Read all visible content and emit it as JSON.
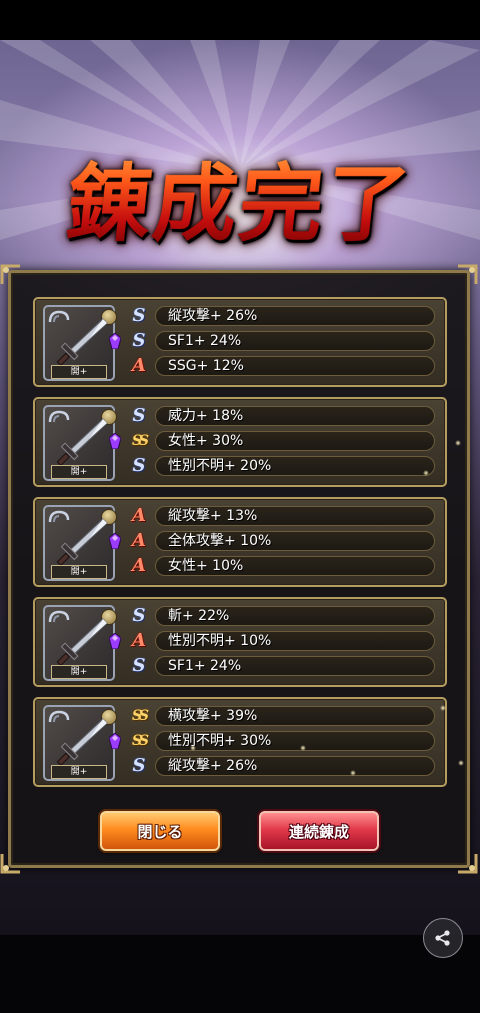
{
  "title": "錬成完了",
  "cards": [
    {
      "tag": "開+",
      "rows": [
        {
          "rank": "S",
          "text": "縦攻撃+ 26%"
        },
        {
          "rank": "S",
          "text": "SF1+ 24%"
        },
        {
          "rank": "A",
          "text": "SSG+ 12%"
        }
      ]
    },
    {
      "tag": "開+",
      "rows": [
        {
          "rank": "S",
          "text": "威力+ 18%"
        },
        {
          "rank": "SS",
          "text": "女性+ 30%"
        },
        {
          "rank": "S",
          "text": "性別不明+ 20%"
        }
      ]
    },
    {
      "tag": "開+",
      "rows": [
        {
          "rank": "A",
          "text": "縦攻撃+ 13%"
        },
        {
          "rank": "A",
          "text": "全体攻撃+ 10%"
        },
        {
          "rank": "A",
          "text": "女性+ 10%"
        }
      ]
    },
    {
      "tag": "開+",
      "rows": [
        {
          "rank": "S",
          "text": "斬+ 22%"
        },
        {
          "rank": "A",
          "text": "性別不明+ 10%"
        },
        {
          "rank": "S",
          "text": "SF1+ 24%"
        }
      ]
    },
    {
      "tag": "開+",
      "rows": [
        {
          "rank": "SS",
          "text": "横攻撃+ 39%"
        },
        {
          "rank": "SS",
          "text": "性別不明+ 30%"
        },
        {
          "rank": "S",
          "text": "縦攻撃+ 26%"
        }
      ]
    }
  ],
  "buttons": {
    "close_label": "閉じる",
    "continue_label": "連続錬成"
  },
  "icons": {
    "share": "share-icon",
    "lock": "chain-lock-icon",
    "weapon": "sword-icon",
    "gem": "purple-gem-icon"
  },
  "colors": {
    "rank_S": "#d6e2ff",
    "rank_A": "#ff8a6a",
    "rank_SS": "#ffd46a",
    "close_button": "#ff8c1f",
    "continue_button": "#e23a4a"
  }
}
